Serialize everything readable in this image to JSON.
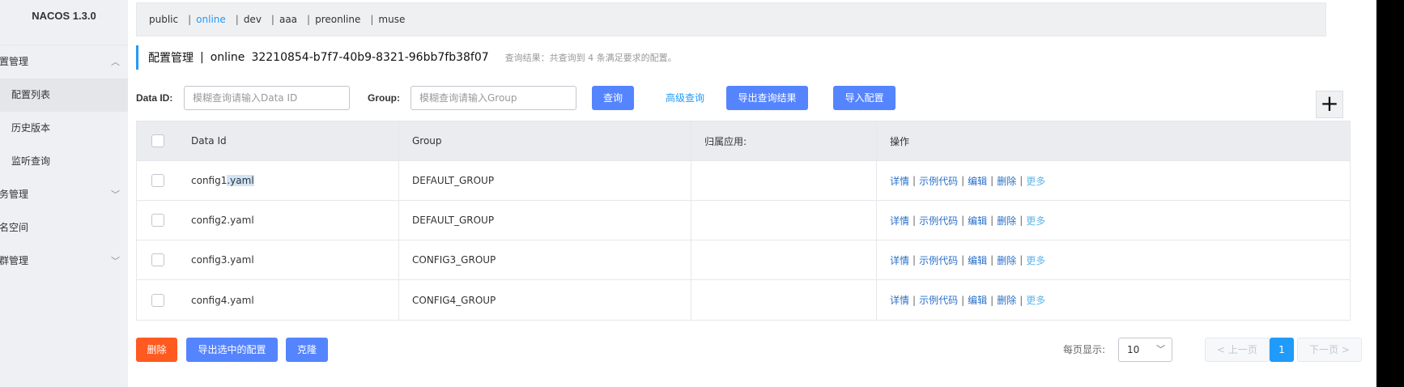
{
  "app": {
    "title": "NACOS 1.3.0"
  },
  "sidebar": {
    "items": [
      {
        "label": "配置管理",
        "level": "top",
        "chevron": "up"
      },
      {
        "label": "配置列表",
        "level": "sub",
        "active": true
      },
      {
        "label": "历史版本",
        "level": "sub"
      },
      {
        "label": "监听查询",
        "level": "sub"
      },
      {
        "label": "服务管理",
        "level": "top",
        "chevron": "down"
      },
      {
        "label": "命名空间",
        "level": "top"
      },
      {
        "label": "集群管理",
        "level": "top",
        "chevron": "down"
      }
    ]
  },
  "namespaces": {
    "items": [
      "public",
      "online",
      "dev",
      "aaa",
      "preonline",
      "muse"
    ],
    "active": "online",
    "separator": "|"
  },
  "header": {
    "title": "配置管理",
    "separator": "|",
    "namespace_name": "online",
    "namespace_id": "32210854-b7f7-40b9-8321-96bb7fb38f07",
    "result_hint": "查询结果：共查询到 4 条满足要求的配置。"
  },
  "search": {
    "data_id_label": "Data ID:",
    "data_id_placeholder": "模糊查询请输入Data ID",
    "group_label": "Group:",
    "group_placeholder": "模糊查询请输入Group",
    "query_button": "查询",
    "advanced_query": "高级查询",
    "export_results_button": "导出查询结果",
    "import_button": "导入配置",
    "add_icon": "plus-icon",
    "add_glyph": "+"
  },
  "table": {
    "columns": [
      "Data Id",
      "Group",
      "归属应用:",
      "操作"
    ],
    "rows": [
      {
        "data_id_prefix": "config1",
        "data_id_highlight": ".yaml",
        "group": "DEFAULT_GROUP",
        "app": ""
      },
      {
        "data_id_prefix": "config2.yaml",
        "data_id_highlight": "",
        "group": "DEFAULT_GROUP",
        "app": ""
      },
      {
        "data_id_prefix": "config3.yaml",
        "data_id_highlight": "",
        "group": "CONFIG3_GROUP",
        "app": ""
      },
      {
        "data_id_prefix": "config4.yaml",
        "data_id_highlight": "",
        "group": "CONFIG4_GROUP",
        "app": ""
      }
    ],
    "ops": {
      "details": "详情",
      "sample_code": "示例代码",
      "edit": "编辑",
      "delete": "删除",
      "more": "更多",
      "separator": "|"
    }
  },
  "bottom": {
    "delete_button": "删除",
    "export_selected_button": "导出选中的配置",
    "clone_button": "克隆",
    "per_page_label": "每页显示:",
    "per_page_value": "10",
    "prev": "上一页",
    "next": "下一页",
    "current_page": "1"
  },
  "colors": {
    "accent": "#209bfa",
    "primary_button": "#5584ff",
    "danger_button": "#ff5a1f",
    "sidebar_bg": "#eef0f3"
  }
}
